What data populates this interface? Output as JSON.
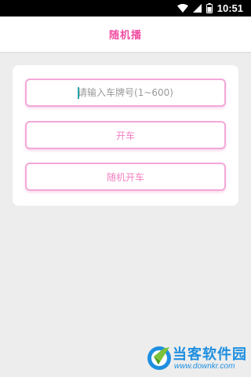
{
  "status_bar": {
    "time": "10:51",
    "icons": [
      "wifi-icon",
      "signal-icon",
      "battery-icon"
    ]
  },
  "app_bar": {
    "title": "随机播"
  },
  "form": {
    "plate_input": {
      "value": "",
      "placeholder": "请输入车牌号(1~600)"
    },
    "start_button_label": "开车",
    "random_button_label": "随机开车"
  },
  "watermark": {
    "title": "当客软件园",
    "url": "www.downkr.com"
  },
  "colors": {
    "accent": "#f24fa3",
    "button_border": "#f3a8d8",
    "button_text": "#f27fc0",
    "background": "#ededed",
    "watermark": "#1e8fe0"
  }
}
